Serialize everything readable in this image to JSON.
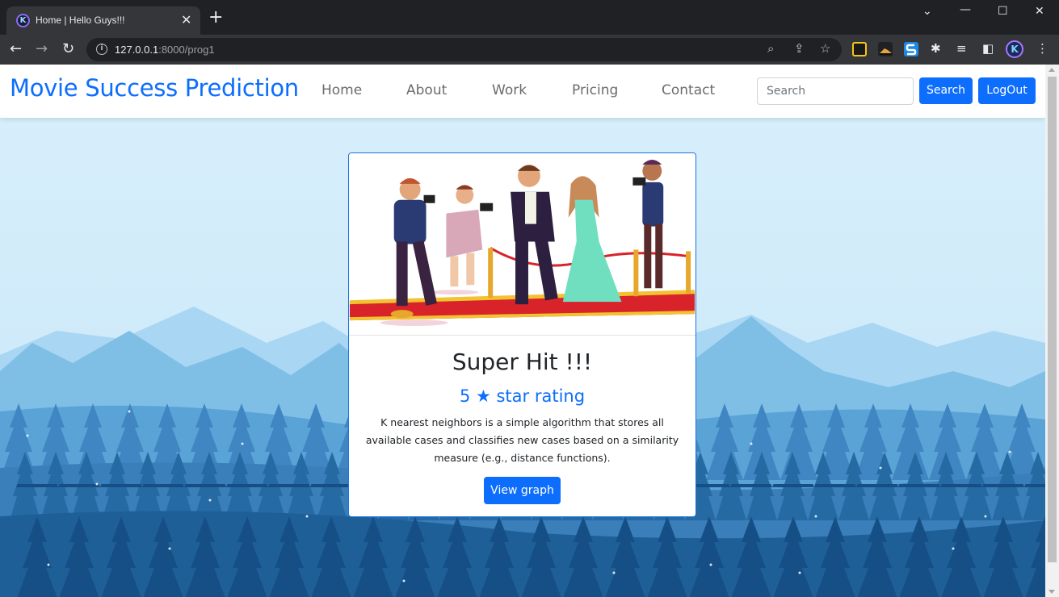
{
  "browser": {
    "tab_title": "Home | Hello Guys!!!",
    "tab_favicon_letter": "K",
    "url_host": "127.0.0.1",
    "url_rest": ":8000/prog1",
    "profile_letter": "K"
  },
  "navbar": {
    "brand": "Movie Success Prediction",
    "links": [
      "Home",
      "About",
      "Work",
      "Pricing",
      "Contact"
    ],
    "search_placeholder": "Search",
    "search_button": "Search",
    "logout_button": "LogOut"
  },
  "card": {
    "title": "Super Hit !!!",
    "rating": "5 ★ star rating",
    "description": "K nearest neighbors is a simple algorithm that stores all available cases and classifies new cases based on a similarity measure (e.g., distance functions).",
    "button": "View graph"
  },
  "colors": {
    "primary": "#0d6efd",
    "card_border": "#1a73e8",
    "sky": "#d7eefb",
    "carpet_red": "#d8232a"
  },
  "icons": {
    "back": "arrow-left-icon",
    "forward": "arrow-right-icon",
    "reload": "reload-icon",
    "site_info": "info-icon",
    "zoom": "zoom-icon",
    "share": "share-icon",
    "bookmark": "star-icon",
    "extensions": "puzzle-icon"
  }
}
